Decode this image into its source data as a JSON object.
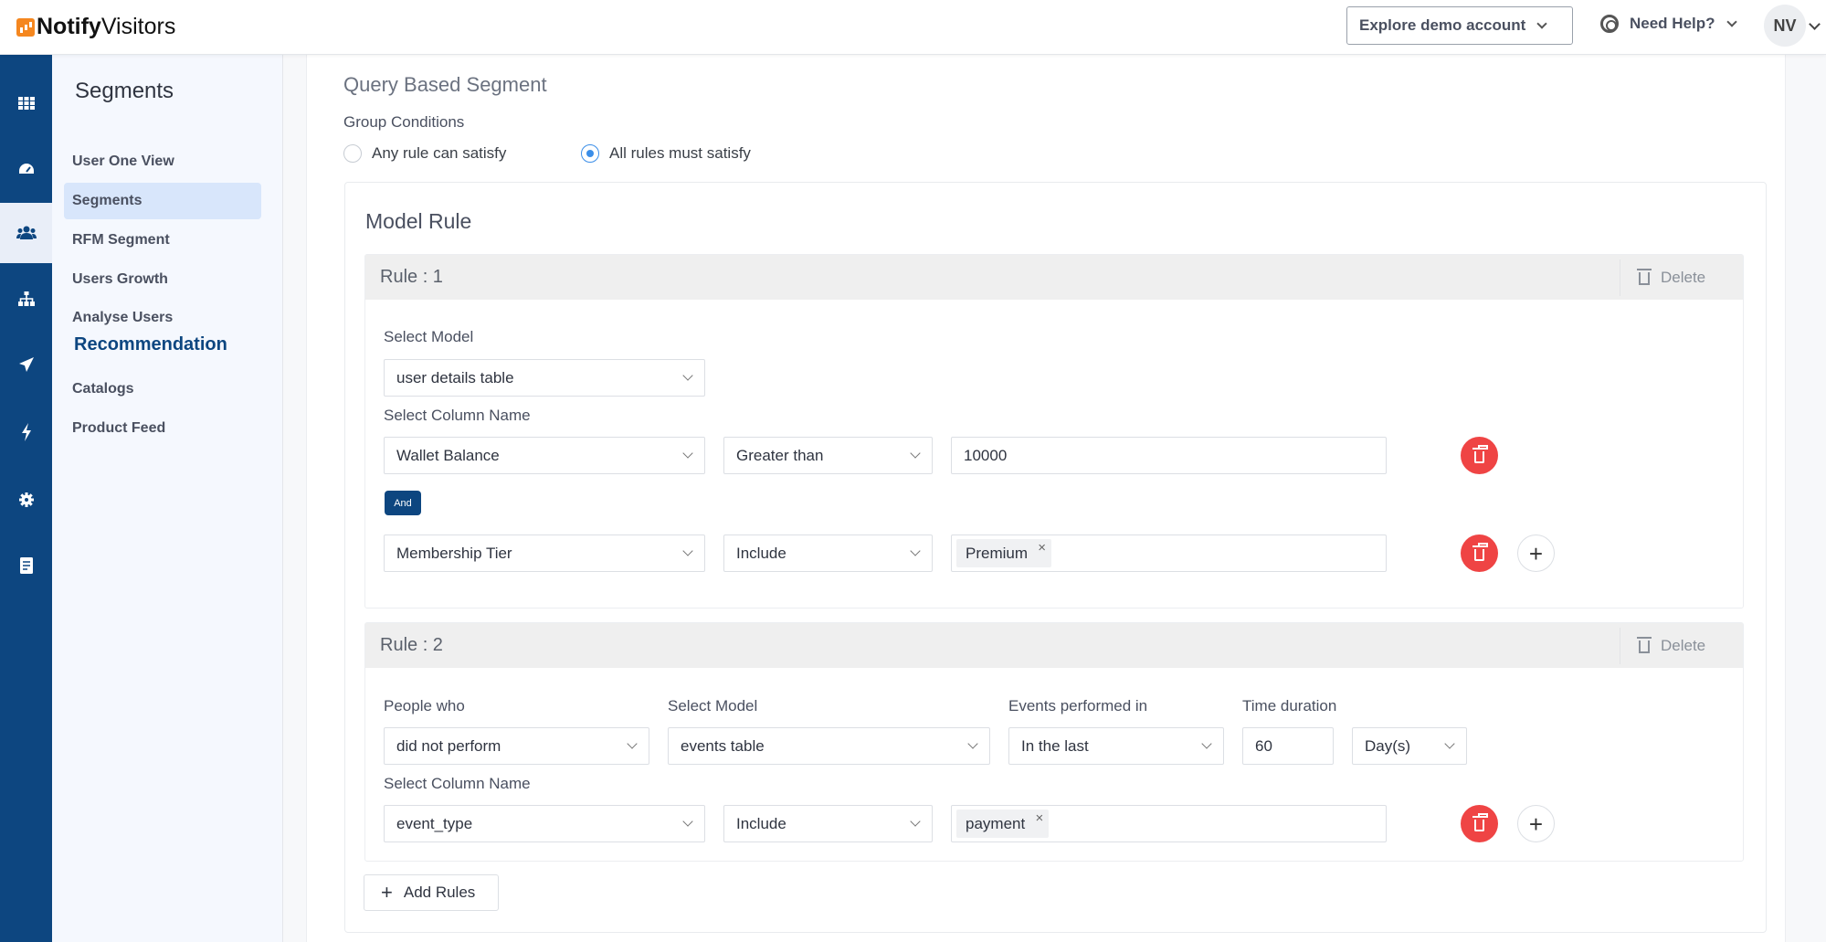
{
  "app": {
    "brand_bold": "Notify",
    "brand_light": "Visitors"
  },
  "header": {
    "demo_label": "Explore demo account",
    "help_label": "Need Help?",
    "avatar_initials": "NV"
  },
  "rail": [
    "grid-icon",
    "dashboard-icon",
    "users-icon",
    "sitemap-icon",
    "send-icon",
    "bolt-icon",
    "gear-icon",
    "report-icon"
  ],
  "subnav": {
    "title": "Segments",
    "items": [
      "User One View",
      "Segments",
      "RFM Segment",
      "Users Growth",
      "Analyse Users"
    ],
    "section_title": "Recommendation",
    "section_items": [
      "Catalogs",
      "Product Feed"
    ]
  },
  "main": {
    "section_title": "Query Based Segment",
    "group_label": "Group Conditions",
    "radio_any": "Any rule can satisfy",
    "radio_all": "All rules must satisfy",
    "model_title": "Model Rule",
    "add_rules_label": "Add Rules",
    "delete_label": "Delete",
    "rule1": {
      "title": "Rule : 1",
      "select_model_label": "Select Model",
      "model_value": "user details table",
      "column_label": "Select Column Name",
      "row1": {
        "column": "Wallet Balance",
        "operator": "Greater than",
        "value": "10000"
      },
      "and_label": "And",
      "row2": {
        "column": "Membership Tier",
        "operator": "Include",
        "tag": "Premium"
      }
    },
    "rule2": {
      "title": "Rule : 2",
      "people_label": "People who",
      "people_value": "did not perform",
      "model_label": "Select Model",
      "model_value": "events table",
      "events_label": "Events performed in",
      "events_value": "In the last",
      "duration_label": "Time duration",
      "duration_value": "60",
      "unit_value": "Day(s)",
      "column_label": "Select Column Name",
      "row": {
        "column": "event_type",
        "operator": "Include",
        "tag": "payment"
      }
    }
  },
  "colors": {
    "brand_blue": "#0d4680",
    "danger": "#ef4444",
    "radio_active": "#3b8ee8",
    "logo_orange": "#f5871f"
  }
}
